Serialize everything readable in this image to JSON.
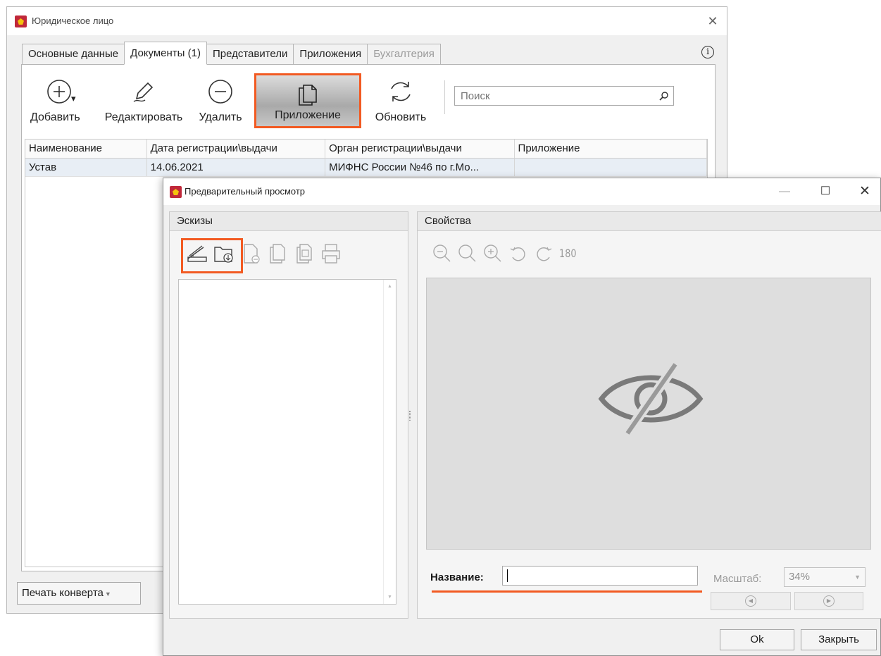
{
  "main_window": {
    "title": "Юридическое лицо",
    "tabs": [
      {
        "label": "Основные данные",
        "active": false,
        "disabled": false
      },
      {
        "label": "Документы (1)",
        "active": true,
        "disabled": false
      },
      {
        "label": "Представители",
        "active": false,
        "disabled": false
      },
      {
        "label": "Приложения",
        "active": false,
        "disabled": false
      },
      {
        "label": "Бухгалтерия",
        "active": false,
        "disabled": true
      }
    ],
    "toolbar": {
      "add_label": "Добавить",
      "edit_label": "Редактировать",
      "delete_label": "Удалить",
      "attachment_label": "Приложение",
      "refresh_label": "Обновить",
      "search_placeholder": "Поиск"
    },
    "grid": {
      "columns": [
        "Наименование",
        "Дата регистрации\\выдачи",
        "Орган регистрации\\выдачи",
        "Приложение"
      ],
      "rows": [
        [
          "Устав",
          "14.06.2021",
          "МИФНС России №46 по г.Мо...",
          ""
        ]
      ]
    },
    "print_envelope_label": "Печать конверта"
  },
  "preview_dialog": {
    "title": "Предварительный просмотр",
    "thumbnails_header": "Эскизы",
    "properties_header": "Свойства",
    "rotate_180_label": "180",
    "name_label": "Название:",
    "name_value": "",
    "scale_label": "Масштаб:",
    "scale_value": "34%",
    "ok_label": "Ok",
    "close_label": "Закрыть"
  },
  "colors": {
    "highlight": "#f25a22",
    "app_icon": "#c0283a"
  }
}
